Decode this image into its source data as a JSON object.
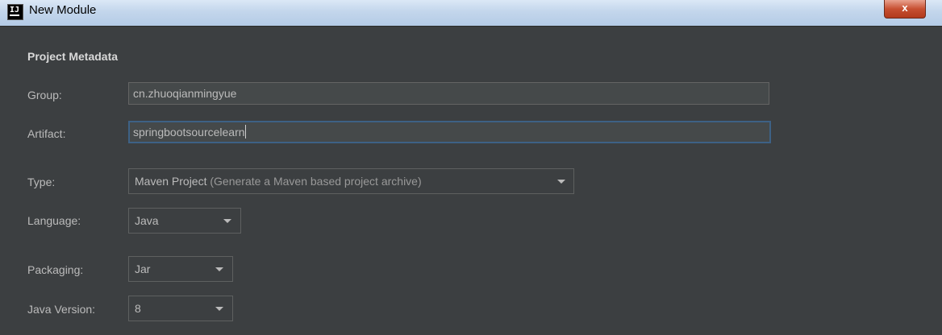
{
  "window": {
    "title": "New Module",
    "app_icon_text": "IJ",
    "close_label": "x"
  },
  "section_title": "Project Metadata",
  "group": {
    "label": "Group:",
    "value": "cn.zhuoqianmingyue"
  },
  "artifact": {
    "label": "Artifact:",
    "value": "springbootsourcelearn"
  },
  "type": {
    "label": "Type:",
    "value": "Maven Project",
    "hint": "(Generate a Maven based project archive)"
  },
  "language": {
    "label": "Language:",
    "value": "Java"
  },
  "packaging": {
    "label": "Packaging:",
    "value": "Jar"
  },
  "java_version": {
    "label": "Java Version:",
    "value": "8"
  },
  "icons": {
    "app": "intellij-idea-icon",
    "dropdown": "chevron-down-icon",
    "close": "close-icon"
  }
}
